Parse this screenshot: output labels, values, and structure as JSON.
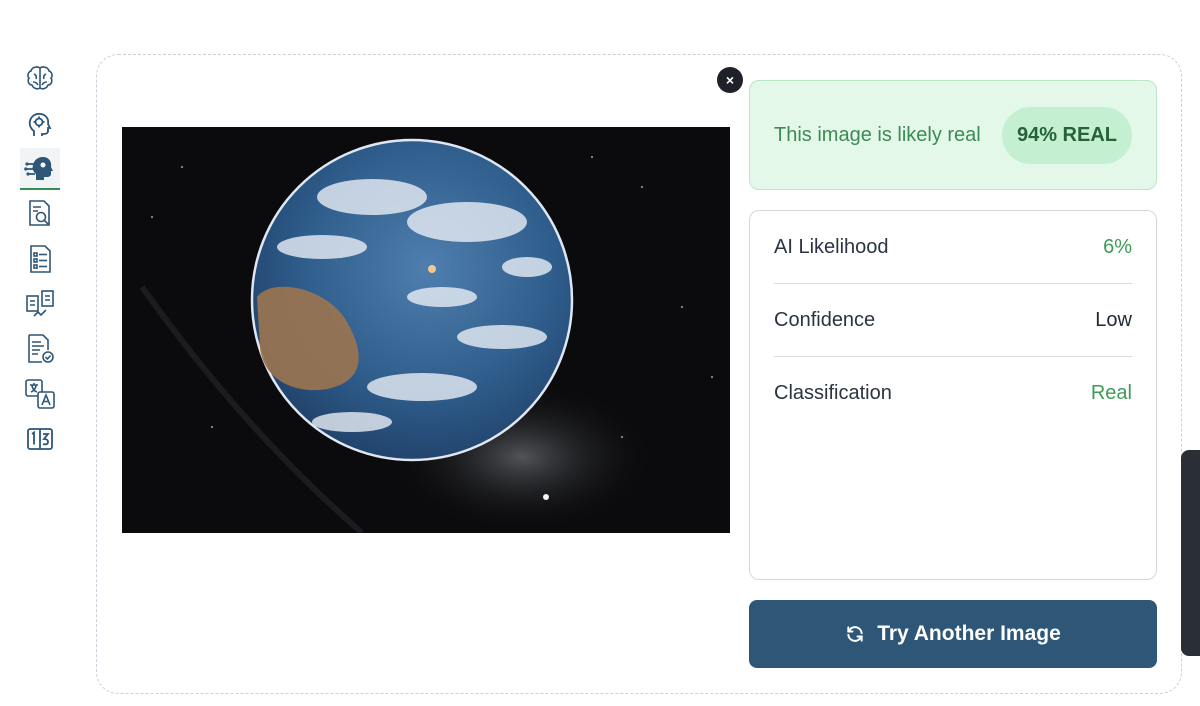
{
  "sidebar": {
    "items": [
      {
        "icon": "brain-icon",
        "active": false
      },
      {
        "icon": "head-gear-icon",
        "active": false
      },
      {
        "icon": "ai-head-icon",
        "active": true
      },
      {
        "icon": "document-search-icon",
        "active": false
      },
      {
        "icon": "checklist-icon",
        "active": false
      },
      {
        "icon": "compare-icon",
        "active": false
      },
      {
        "icon": "document-check-icon",
        "active": false
      },
      {
        "icon": "translate-icon",
        "active": false
      },
      {
        "icon": "number-tiles-icon",
        "active": false
      }
    ]
  },
  "result": {
    "verdict_text": "This image is likely real",
    "badge": "94% REAL",
    "metrics": [
      {
        "label": "AI Likelihood",
        "value": "6%"
      },
      {
        "label": "Confidence",
        "value": "Low"
      },
      {
        "label": "Classification",
        "value": "Real"
      }
    ],
    "close_label": "×",
    "try_again_label": "Try Another Image"
  },
  "colors": {
    "accent": "#2d5677",
    "success": "#3f9a55",
    "success_bg": "#e4f8e9"
  }
}
